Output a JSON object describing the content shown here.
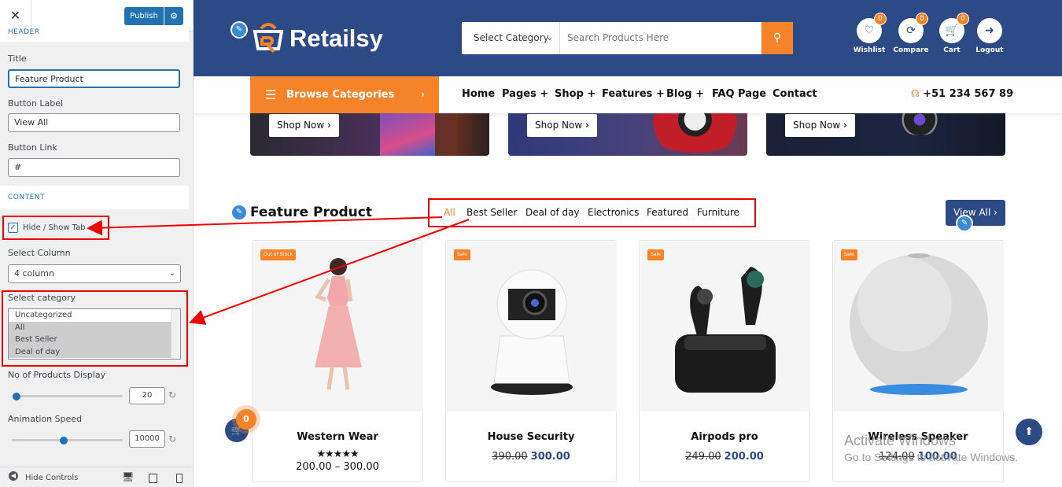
{
  "panel": {
    "close_icon": "close-icon",
    "publish_label": "Publish",
    "header_section": "HEADER",
    "title_label": "Title",
    "title_value": "Feature Product",
    "button_label_label": "Button Label",
    "button_label_value": "View All",
    "button_link_label": "Button Link",
    "button_link_value": "#",
    "content_section": "CONTENT",
    "hide_show_tab_label": "Hide / Show Tab",
    "hide_show_tab_checked": true,
    "select_column_label": "Select Column",
    "select_column_value": "4 column",
    "select_category_label": "Select category",
    "categories": [
      {
        "label": "Uncategorized",
        "selected": false
      },
      {
        "label": "All",
        "selected": true
      },
      {
        "label": "Best Seller",
        "selected": true
      },
      {
        "label": "Deal of day",
        "selected": true
      }
    ],
    "no_of_products_label": "No of Products Display",
    "no_of_products_value": "20",
    "animation_speed_label": "Animation Speed",
    "animation_speed_value": "10000",
    "hide_controls_label": "Hide Controls"
  },
  "site": {
    "brand": "Retailsy",
    "brand_colors": {
      "navy": "#2c4a86",
      "orange": "#f4832a"
    },
    "search": {
      "category_label": "Select Category",
      "placeholder": "Search Products Here"
    },
    "header_icons": [
      {
        "name": "wishlist",
        "label": "Wishlist",
        "count": "0"
      },
      {
        "name": "compare",
        "label": "Compare",
        "count": "0"
      },
      {
        "name": "cart",
        "label": "Cart",
        "count": "0"
      },
      {
        "name": "logout",
        "label": "Logout"
      }
    ],
    "browse_label": "Browse Categories",
    "nav": [
      "Home",
      "Pages +",
      "Shop +",
      "Features +",
      "Blog +",
      "FAQ Page",
      "Contact"
    ],
    "phone": "+51 234 567 89",
    "banners": [
      {
        "button": "Shop Now ›"
      },
      {
        "button": "Shop Now ›"
      },
      {
        "button": "Shop Now ›"
      }
    ],
    "section_title": "Feature Product",
    "tabs": [
      "All",
      "Best Seller",
      "Deal of day",
      "Electronics",
      "Featured",
      "Furniture"
    ],
    "active_tab": "All",
    "view_all": "View All ›",
    "products": [
      {
        "tag": "Out of Stock",
        "name": "Western Wear",
        "rating": "★★★★★",
        "price_range": "200.00 – 300.00"
      },
      {
        "tag": "Sale",
        "name": "House Security",
        "old_price": "390.00",
        "price": "300.00"
      },
      {
        "tag": "Sale",
        "name": "Airpods pro",
        "old_price": "249.00",
        "price": "200.00"
      },
      {
        "tag": "Sale",
        "name": "Wireless Speaker",
        "old_price": "124.00",
        "price": "100.00"
      }
    ],
    "floating_cart_count": "0",
    "watermark_title": "Activate Windows",
    "watermark_sub": "Go to Settings to activate Windows."
  }
}
